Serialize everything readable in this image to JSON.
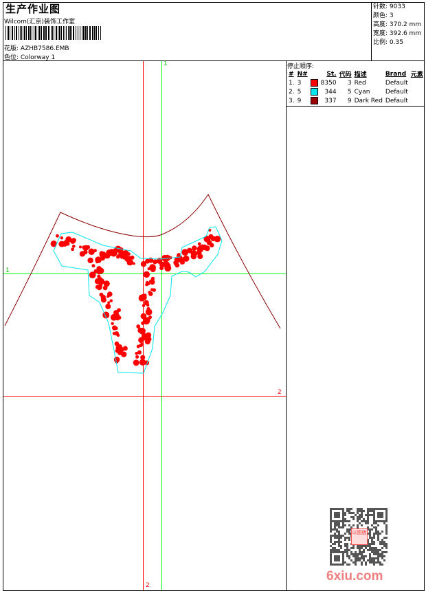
{
  "header": {
    "title": "生产作业图",
    "studio": "Wilcom(汇京)装饰工作室",
    "design_label": "花版:",
    "design_value": "AZHB7586.EMB",
    "colorway_label": "色位:",
    "colorway_value": "Colorway 1"
  },
  "info": [
    {
      "label": "针数:",
      "value": "9033"
    },
    {
      "label": "颜色:",
      "value": "3"
    },
    {
      "label": "高度:",
      "value": "370.2 mm"
    },
    {
      "label": "宽度:",
      "value": "392.6 mm"
    },
    {
      "label": "比例:",
      "value": "0.35"
    }
  ],
  "stop_sequence": {
    "title": "停止顺序:",
    "headers": [
      "#",
      "N#",
      "St.",
      "代码",
      "描述",
      "Brand",
      "元素"
    ],
    "rows": [
      {
        "idx": "1.",
        "n": "3",
        "color": "#ff0000",
        "st": "8350",
        "code": "3",
        "desc": "Red",
        "brand": "Default"
      },
      {
        "idx": "2.",
        "n": "5",
        "color": "#00e5ee",
        "st": "344",
        "code": "5",
        "desc": "Cyan",
        "brand": "Default"
      },
      {
        "idx": "3.",
        "n": "9",
        "color": "#990000",
        "st": "337",
        "code": "9",
        "desc": "Dark Red",
        "brand": "Default"
      }
    ]
  },
  "guides": {
    "v1": "1",
    "h1": "1",
    "h2": "2",
    "v2": "2"
  },
  "watermark": {
    "text": "6xiu.com",
    "stamp": "以图版"
  },
  "colors": {
    "red": "#ff0000",
    "green": "#00ff00",
    "cyan": "#00e5ee",
    "darkred": "#8b0000"
  }
}
